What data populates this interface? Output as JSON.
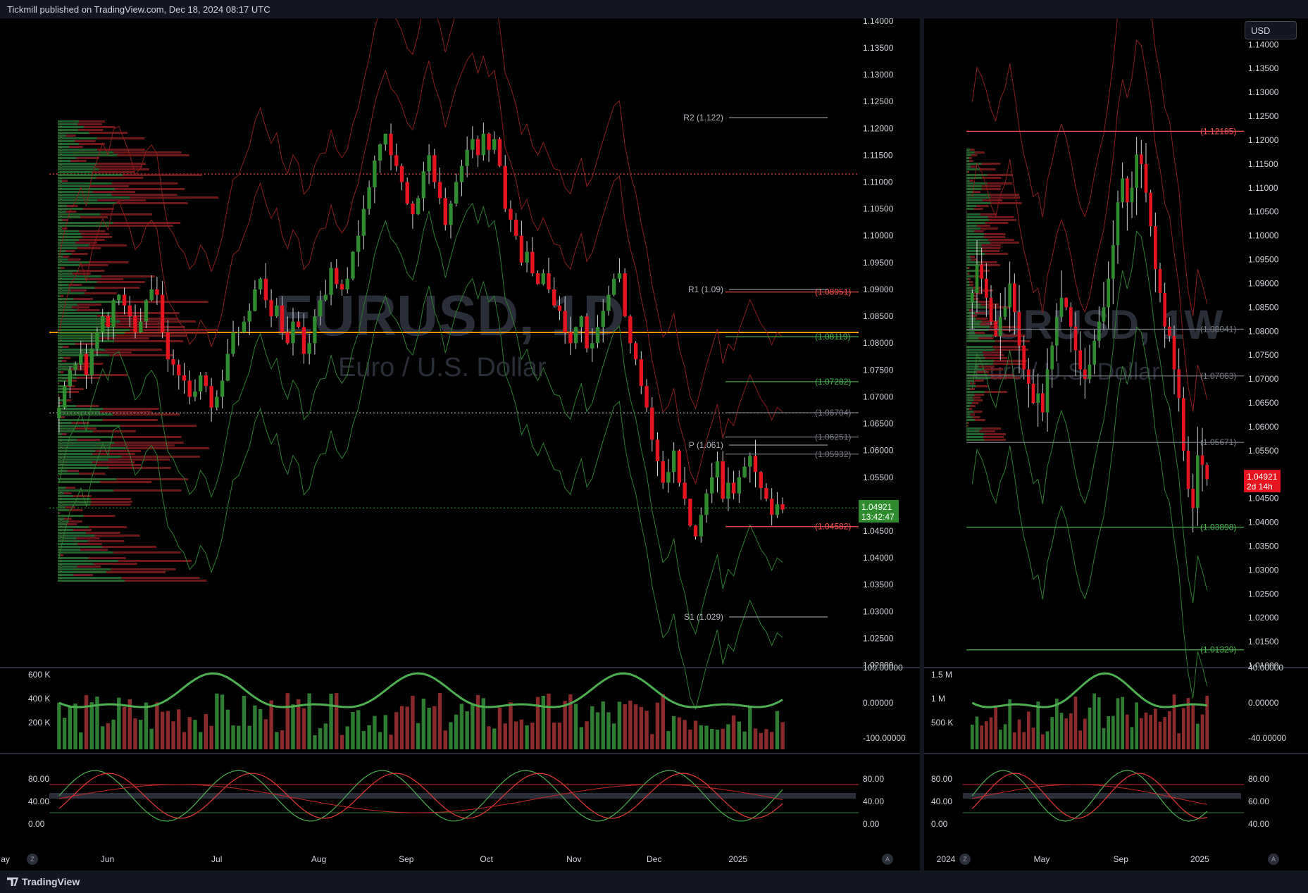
{
  "header": {
    "published_text": "Tickmill published on TradingView.com, Dec 18, 2024 08:17 UTC"
  },
  "footer": {
    "brand": "TradingView"
  },
  "toolbar": {
    "currency_label": "USD",
    "zoom_btn": "Z",
    "auto_btn": "A"
  },
  "colors": {
    "up": "#26a69a",
    "up_candle": "#2e8b2e",
    "down_candle": "#e5141f",
    "bull_line": "#4caf50",
    "bear_line": "#c62828",
    "orange": "#ff9800"
  },
  "chart_data": [
    {
      "type": "candlestick",
      "symbol_watermark": "EURUSD, 1D",
      "subtitle_watermark": "Euro / U.S. Dollar",
      "x_tick_labels": [
        "ay",
        "Jun",
        "Jul",
        "Aug",
        "Sep",
        "Oct",
        "Nov",
        "Dec",
        "2025"
      ],
      "y_tick_labels": [
        "1.14000",
        "1.13500",
        "1.13000",
        "1.12500",
        "1.12000",
        "1.11500",
        "1.11000",
        "1.10500",
        "1.10000",
        "1.09500",
        "1.09000",
        "1.08500",
        "1.08000",
        "1.07500",
        "1.07000",
        "1.06500",
        "1.06000",
        "1.05500",
        "1.05000",
        "1.04500",
        "1.04000",
        "1.03500",
        "1.03000",
        "1.02500",
        "1.02000"
      ],
      "ylim": [
        1.0185,
        1.1405
      ],
      "last_price": "1.04921",
      "countdown": "13:42:47",
      "pivot_labels": [
        {
          "label": "R2 (1.122)",
          "value": 1.122
        },
        {
          "label": "R1 (1.09)",
          "value": 1.09
        },
        {
          "label": "P (1.061)",
          "value": 1.061
        },
        {
          "label": "S1 (1.029)",
          "value": 1.029
        }
      ],
      "level_labels": [
        {
          "label": "(1.08951)",
          "value": 1.08951,
          "color": "#ff5252"
        },
        {
          "label": "(1.08119)",
          "value": 1.08119,
          "color": "#4caf50"
        },
        {
          "label": "(1.07282)",
          "value": 1.07282,
          "color": "#4caf50"
        },
        {
          "label": "(1.06704)",
          "value": 1.06704,
          "color": "#787b86"
        },
        {
          "label": "(1.06251)",
          "value": 1.06251,
          "color": "#787b86"
        },
        {
          "label": "(1.05932)",
          "value": 1.05932,
          "color": "#787b86"
        },
        {
          "label": "(1.04582)",
          "value": 1.04582,
          "color": "#ff5252"
        }
      ],
      "hlines": [
        {
          "value": 1.1115,
          "style": "dotted",
          "color": "#ff5252"
        },
        {
          "value": 1.082,
          "style": "solid",
          "color": "#ff9800"
        },
        {
          "value": 1.067,
          "style": "dotted",
          "color": "#b0b0b0"
        },
        {
          "value": 1.0493,
          "style": "dotted",
          "color": "#2e7d32"
        }
      ],
      "closes": [
        1.068,
        1.072,
        1.075,
        1.076,
        1.078,
        1.074,
        1.079,
        1.082,
        1.085,
        1.083,
        1.088,
        1.089,
        1.087,
        1.085,
        1.082,
        1.084,
        1.088,
        1.09,
        1.089,
        1.082,
        1.077,
        1.076,
        1.074,
        1.073,
        1.07,
        1.071,
        1.074,
        1.072,
        1.068,
        1.07,
        1.073,
        1.078,
        1.082,
        1.082,
        1.084,
        1.086,
        1.09,
        1.092,
        1.088,
        1.085,
        1.087,
        1.082,
        1.08,
        1.084,
        1.083,
        1.078,
        1.08,
        1.085,
        1.088,
        1.089,
        1.094,
        1.091,
        1.09,
        1.092,
        1.097,
        1.1,
        1.105,
        1.109,
        1.114,
        1.117,
        1.119,
        1.115,
        1.113,
        1.11,
        1.106,
        1.104,
        1.107,
        1.112,
        1.115,
        1.11,
        1.107,
        1.102,
        1.106,
        1.11,
        1.113,
        1.116,
        1.118,
        1.115,
        1.119,
        1.116,
        1.118,
        1.113,
        1.105,
        1.103,
        1.1,
        1.095,
        1.097,
        1.093,
        1.091,
        1.093,
        1.09,
        1.087,
        1.086,
        1.082,
        1.08,
        1.083,
        1.085,
        1.079,
        1.08,
        1.083,
        1.086,
        1.089,
        1.092,
        1.093,
        1.085,
        1.08,
        1.077,
        1.072,
        1.068,
        1.062,
        1.058,
        1.054,
        1.056,
        1.06,
        1.054,
        1.051,
        1.046,
        1.044,
        1.048,
        1.052,
        1.055,
        1.058,
        1.051,
        1.054,
        1.052,
        1.055,
        1.057,
        1.059,
        1.056,
        1.053,
        1.051,
        1.048,
        1.05,
        1.049
      ],
      "volume_axis_labels": [
        "600 K",
        "400 K",
        "200 K"
      ],
      "osc_axis_labels": [
        "100.00000",
        "0.00000",
        "-100.00000"
      ],
      "stoch_axis_labels": [
        "80.00",
        "40.00",
        "0.00"
      ],
      "stoch_right_labels": [
        "80.00",
        "40.00",
        "0.00"
      ]
    },
    {
      "type": "candlestick",
      "symbol_watermark": "EURUSD, 1W",
      "subtitle_watermark": "Euro / U.S. Dollar",
      "x_tick_labels": [
        "2024",
        "May",
        "Sep",
        "2025"
      ],
      "y_tick_labels": [
        "1.14000",
        "1.13500",
        "1.13000",
        "1.12500",
        "1.12000",
        "1.11500",
        "1.11000",
        "1.10500",
        "1.10000",
        "1.09500",
        "1.09000",
        "1.08500",
        "1.08000",
        "1.07500",
        "1.07000",
        "1.06500",
        "1.06000",
        "1.05500",
        "1.05000",
        "1.04500",
        "1.04000",
        "1.03500",
        "1.03000",
        "1.02500",
        "1.02000",
        "1.01500",
        "1.01000"
      ],
      "ylim": [
        1.0075,
        1.1455
      ],
      "last_price": "1.04921",
      "countdown": "2d 14h",
      "level_labels": [
        {
          "label": "(1.12185)",
          "value": 1.12185,
          "color": "#ff5252"
        },
        {
          "label": "(1.08041)",
          "value": 1.08041,
          "color": "#787b86"
        },
        {
          "label": "(1.07063)",
          "value": 1.07063,
          "color": "#787b86"
        },
        {
          "label": "(1.05671)",
          "value": 1.05671,
          "color": "#787b86"
        },
        {
          "label": "(1.03898)",
          "value": 1.03898,
          "color": "#4caf50"
        },
        {
          "label": "(1.01329)",
          "value": 1.01329,
          "color": "#4caf50"
        }
      ],
      "closes": [
        1.088,
        1.094,
        1.091,
        1.087,
        1.082,
        1.079,
        1.083,
        1.085,
        1.09,
        1.084,
        1.077,
        1.072,
        1.069,
        1.065,
        1.067,
        1.063,
        1.072,
        1.077,
        1.083,
        1.087,
        1.085,
        1.081,
        1.076,
        1.072,
        1.07,
        1.073,
        1.078,
        1.082,
        1.085,
        1.091,
        1.098,
        1.107,
        1.112,
        1.107,
        1.11,
        1.117,
        1.115,
        1.109,
        1.102,
        1.093,
        1.088,
        1.081,
        1.079,
        1.072,
        1.066,
        1.055,
        1.047,
        1.043,
        1.054,
        1.052,
        1.049
      ],
      "volume_axis_labels": [
        "1.5 M",
        "1 M",
        "500 K"
      ],
      "osc_axis_labels": [
        "40.00000",
        "0.00000",
        "-40.00000"
      ],
      "stoch_axis_labels": [
        "80.00",
        "40.00",
        "0.00"
      ],
      "stoch_right_labels": [
        "80.00",
        "60.00",
        "40.00"
      ]
    }
  ]
}
